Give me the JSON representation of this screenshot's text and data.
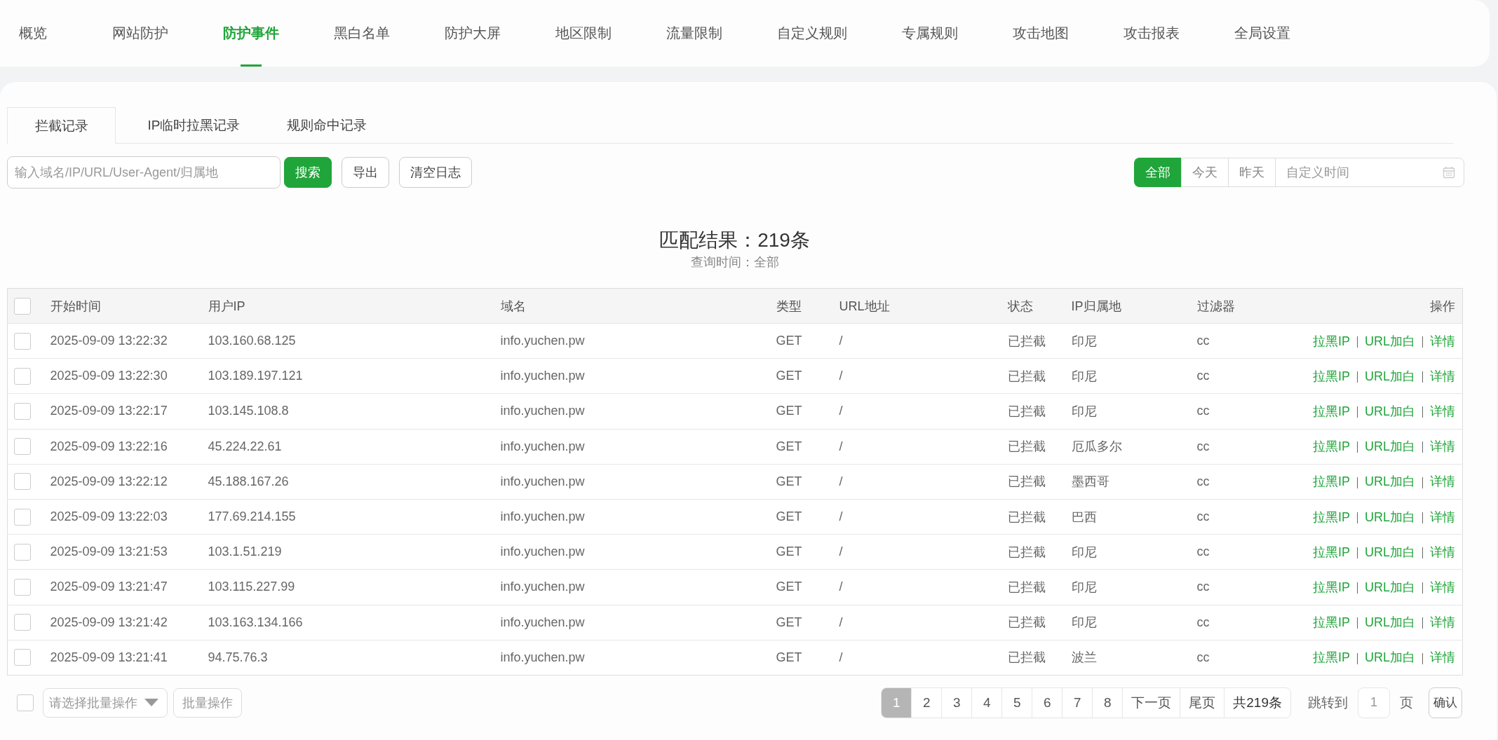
{
  "nav": {
    "items": [
      {
        "label": "概览",
        "selected": false
      },
      {
        "label": "网站防护",
        "selected": false
      },
      {
        "label": "防护事件",
        "selected": true
      },
      {
        "label": "黑白名单",
        "selected": false
      },
      {
        "label": "防护大屏",
        "selected": false
      },
      {
        "label": "地区限制",
        "selected": false
      },
      {
        "label": "流量限制",
        "selected": false
      },
      {
        "label": "自定义规则",
        "selected": false
      },
      {
        "label": "专属规则",
        "selected": false
      },
      {
        "label": "攻击地图",
        "selected": false
      },
      {
        "label": "攻击报表",
        "selected": false
      },
      {
        "label": "全局设置",
        "selected": false
      }
    ]
  },
  "subtabs": [
    {
      "label": "拦截记录",
      "selected": true
    },
    {
      "label": "IP临时拉黑记录",
      "selected": false
    },
    {
      "label": "规则命中记录",
      "selected": false
    }
  ],
  "toolbar": {
    "search": {
      "placeholder": "输入域名/IP/URL/User-Agent/归属地"
    },
    "search_button": "搜索",
    "buttons": [
      "导出",
      "清空日志"
    ],
    "ranges": [
      {
        "label": "全部",
        "selected": true
      },
      {
        "label": "今天",
        "selected": false
      },
      {
        "label": "昨天",
        "selected": false
      }
    ],
    "custom_time": {
      "placeholder": "自定义时间"
    }
  },
  "summary": {
    "title": "匹配结果：219条",
    "subtitle": "查询时间：全部"
  },
  "table": {
    "select_all": {
      "checked": false
    },
    "columns": [
      "开始时间",
      "用户IP",
      "域名",
      "类型",
      "URL地址",
      "状态",
      "IP归属地",
      "过滤器",
      "操作"
    ],
    "rows": [
      {
        "checked": false,
        "cells": [
          "2025-09-09 13:22:32",
          "103.160.68.125",
          "info.yuchen.pw",
          "GET",
          "/",
          "已拦截",
          "印尼",
          "cc"
        ],
        "actions": [
          "拉黑IP",
          "URL加白",
          "详情"
        ]
      },
      {
        "checked": false,
        "cells": [
          "2025-09-09 13:22:30",
          "103.189.197.121",
          "info.yuchen.pw",
          "GET",
          "/",
          "已拦截",
          "印尼",
          "cc"
        ],
        "actions": [
          "拉黑IP",
          "URL加白",
          "详情"
        ]
      },
      {
        "checked": false,
        "cells": [
          "2025-09-09 13:22:17",
          "103.145.108.8",
          "info.yuchen.pw",
          "GET",
          "/",
          "已拦截",
          "印尼",
          "cc"
        ],
        "actions": [
          "拉黑IP",
          "URL加白",
          "详情"
        ]
      },
      {
        "checked": false,
        "cells": [
          "2025-09-09 13:22:16",
          "45.224.22.61",
          "info.yuchen.pw",
          "GET",
          "/",
          "已拦截",
          "厄瓜多尔",
          "cc"
        ],
        "actions": [
          "拉黑IP",
          "URL加白",
          "详情"
        ]
      },
      {
        "checked": false,
        "cells": [
          "2025-09-09 13:22:12",
          "45.188.167.26",
          "info.yuchen.pw",
          "GET",
          "/",
          "已拦截",
          "墨西哥",
          "cc"
        ],
        "actions": [
          "拉黑IP",
          "URL加白",
          "详情"
        ]
      },
      {
        "checked": false,
        "cells": [
          "2025-09-09 13:22:03",
          "177.69.214.155",
          "info.yuchen.pw",
          "GET",
          "/",
          "已拦截",
          "巴西",
          "cc"
        ],
        "actions": [
          "拉黑IP",
          "URL加白",
          "详情"
        ]
      },
      {
        "checked": false,
        "cells": [
          "2025-09-09 13:21:53",
          "103.1.51.219",
          "info.yuchen.pw",
          "GET",
          "/",
          "已拦截",
          "印尼",
          "cc"
        ],
        "actions": [
          "拉黑IP",
          "URL加白",
          "详情"
        ]
      },
      {
        "checked": false,
        "cells": [
          "2025-09-09 13:21:47",
          "103.115.227.99",
          "info.yuchen.pw",
          "GET",
          "/",
          "已拦截",
          "印尼",
          "cc"
        ],
        "actions": [
          "拉黑IP",
          "URL加白",
          "详情"
        ]
      },
      {
        "checked": false,
        "cells": [
          "2025-09-09 13:21:42",
          "103.163.134.166",
          "info.yuchen.pw",
          "GET",
          "/",
          "已拦截",
          "印尼",
          "cc"
        ],
        "actions": [
          "拉黑IP",
          "URL加白",
          "详情"
        ]
      },
      {
        "checked": false,
        "cells": [
          "2025-09-09 13:21:41",
          "94.75.76.3",
          "info.yuchen.pw",
          "GET",
          "/",
          "已拦截",
          "波兰",
          "cc"
        ],
        "actions": [
          "拉黑IP",
          "URL加白",
          "详情"
        ]
      }
    ]
  },
  "footer": {
    "batch_checkbox": {
      "checked": false
    },
    "batch_select": {
      "placeholder": "请选择批量操作"
    },
    "batch_button": "批量操作",
    "pages": [
      {
        "label": "1",
        "selected": true
      },
      {
        "label": "2",
        "selected": false
      },
      {
        "label": "3",
        "selected": false
      },
      {
        "label": "4",
        "selected": false
      },
      {
        "label": "5",
        "selected": false
      },
      {
        "label": "6",
        "selected": false
      },
      {
        "label": "7",
        "selected": false
      },
      {
        "label": "8",
        "selected": false
      }
    ],
    "next": "下一页",
    "last": "尾页",
    "total": "共219条",
    "jump_label": "跳转到",
    "jump_value": "1",
    "jump_unit": "页",
    "confirm": "确认"
  }
}
